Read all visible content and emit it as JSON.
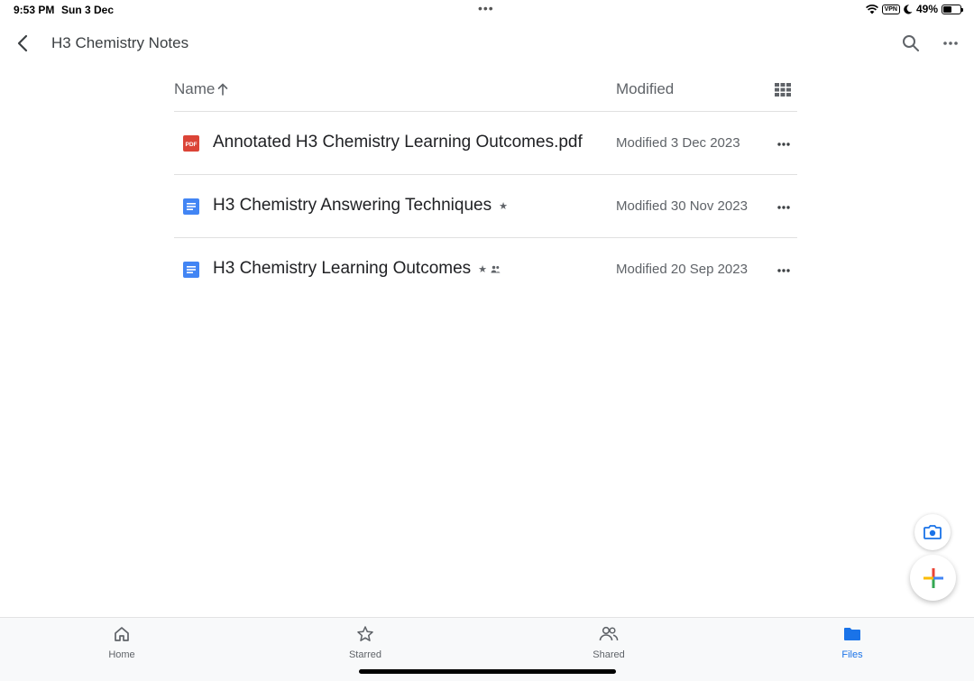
{
  "status_bar": {
    "time": "9:53 PM",
    "date": "Sun 3 Dec",
    "multitask_dots": "•••",
    "vpn": "VPN",
    "battery": "49%",
    "battery_level": 0.49
  },
  "app_bar": {
    "title": "H3 Chemistry Notes",
    "back_icon": "chevron-left-icon",
    "search_icon": "search-icon",
    "more_icon": "more-horizontal-icon"
  },
  "list_header": {
    "name_label": "Name",
    "sort_icon": "arrow-up-icon",
    "modified_label": "Modified",
    "view_icon": "grid-view-icon"
  },
  "files": [
    {
      "name": "Annotated H3 Chemistry Learning Outcomes.pdf",
      "type": "pdf",
      "pdf_label": "PDF",
      "modified": "Modified 3 Dec 2023",
      "starred": false,
      "shared": false
    },
    {
      "name": "H3 Chemistry Answering Techniques",
      "type": "doc",
      "modified": "Modified 30 Nov 2023",
      "starred": true,
      "shared": false
    },
    {
      "name": "H3 Chemistry Learning Outcomes",
      "type": "doc",
      "modified": "Modified 20 Sep 2023",
      "starred": true,
      "shared": true
    }
  ],
  "badges": {
    "star": "★"
  },
  "fabs": {
    "camera_icon": "camera-icon",
    "add_icon": "plus-icon"
  },
  "bottom_nav": {
    "items": [
      {
        "label": "Home",
        "icon": "home-icon",
        "active": false
      },
      {
        "label": "Starred",
        "icon": "star-icon",
        "active": false
      },
      {
        "label": "Shared",
        "icon": "people-icon",
        "active": false
      },
      {
        "label": "Files",
        "icon": "folder-icon",
        "active": true
      }
    ]
  },
  "colors": {
    "accent": "#1a73e8",
    "pdf_red": "#db4437",
    "doc_blue": "#4285f4"
  }
}
